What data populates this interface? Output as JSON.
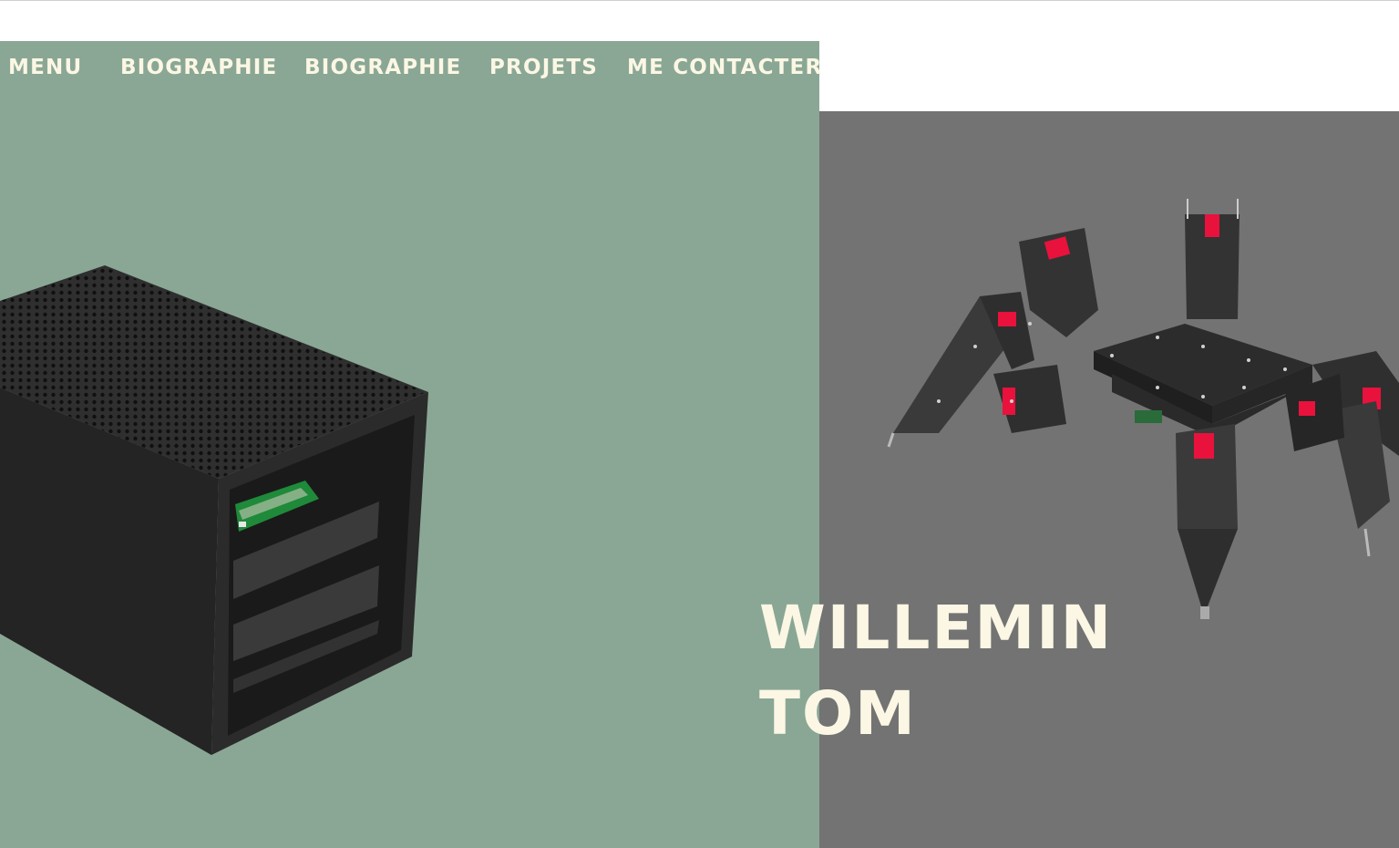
{
  "nav": {
    "items": [
      {
        "label": "MENU"
      },
      {
        "label": "BIOGRAPHIE"
      },
      {
        "label": "BIOGRAPHIE"
      },
      {
        "label": "PROJETS"
      },
      {
        "label": "ME CONTACTER"
      }
    ]
  },
  "hero": {
    "last_name": "WILLEMIN",
    "first_name": "TOM"
  },
  "colors": {
    "green_panel": "#8aa795",
    "gray_panel": "#737373",
    "text_cream": "#fbf7e4"
  },
  "images": [
    {
      "icon": "server-case-render"
    },
    {
      "icon": "hexapod-robot-render"
    }
  ]
}
